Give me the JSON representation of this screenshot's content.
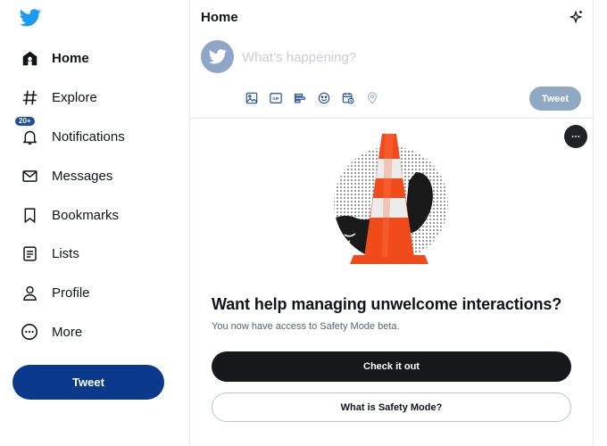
{
  "sidebar": {
    "logo": "twitter-bird-icon",
    "items": [
      {
        "label": "Home",
        "icon": "home-icon",
        "active": true
      },
      {
        "label": "Explore",
        "icon": "hashtag-icon"
      },
      {
        "label": "Notifications",
        "icon": "bell-icon",
        "badge": "20+"
      },
      {
        "label": "Messages",
        "icon": "envelope-icon"
      },
      {
        "label": "Bookmarks",
        "icon": "bookmark-icon"
      },
      {
        "label": "Lists",
        "icon": "list-icon"
      },
      {
        "label": "Profile",
        "icon": "person-icon"
      },
      {
        "label": "More",
        "icon": "more-circle-icon"
      }
    ],
    "tweet_button": "Tweet"
  },
  "header": {
    "title": "Home",
    "top_tweets_icon": "sparkle-icon"
  },
  "composer": {
    "placeholder": "What’s happening?",
    "tools": [
      "image-icon",
      "gif-icon",
      "poll-icon",
      "emoji-icon",
      "schedule-icon",
      "location-icon"
    ],
    "gif_text": "GIF",
    "tweet_button": "Tweet"
  },
  "safety_card": {
    "title": "Want help managing unwelcome interactions?",
    "subtitle": "You now have access to Safety Mode beta.",
    "primary_button": "Check it out",
    "secondary_button": "What is Safety Mode?"
  },
  "colors": {
    "brand_blue": "#1d9bf0",
    "sidebar_tweet": "#0b3a8c",
    "cone_orange": "#f04b1a"
  }
}
